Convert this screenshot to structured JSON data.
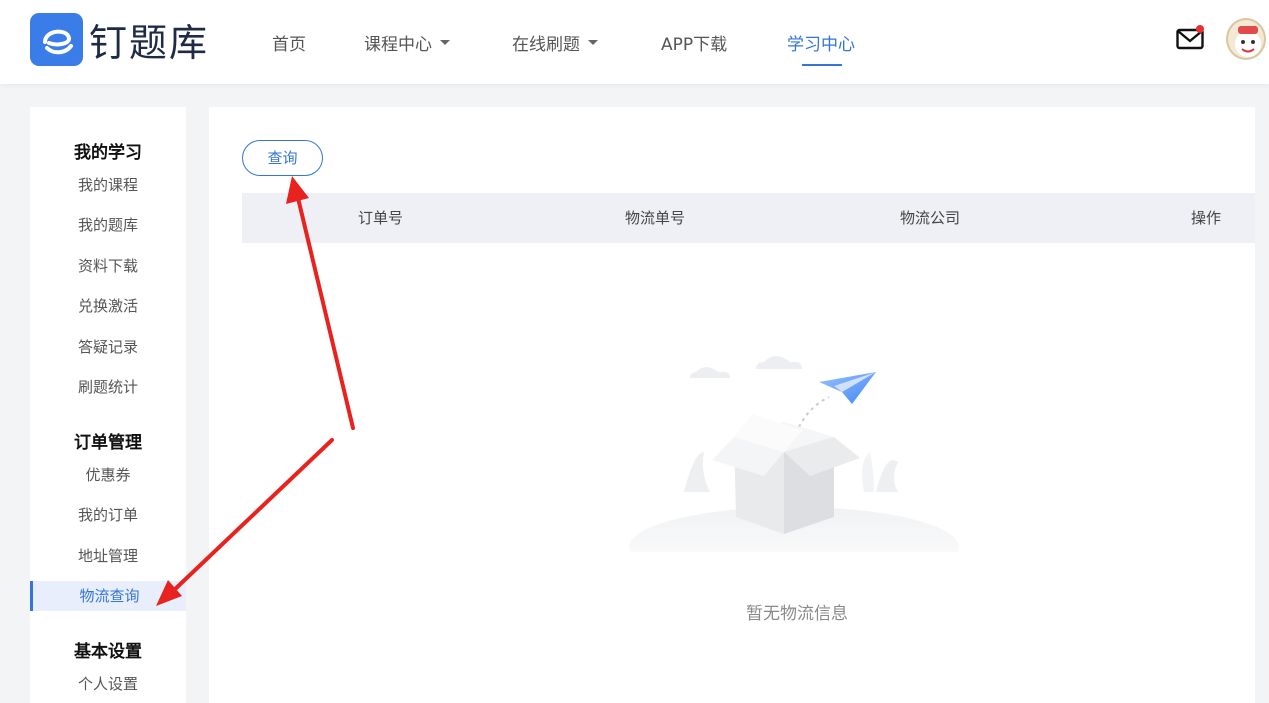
{
  "header": {
    "logo_text": "钉题库",
    "nav": [
      {
        "label": "首页",
        "dropdown": false,
        "active": false
      },
      {
        "label": "课程中心",
        "dropdown": true,
        "active": false
      },
      {
        "label": "在线刷题",
        "dropdown": true,
        "active": false
      },
      {
        "label": "APP下载",
        "dropdown": false,
        "active": false
      },
      {
        "label": "学习中心",
        "dropdown": false,
        "active": true
      }
    ],
    "accent_color": "#3575d8",
    "notification_dot_color": "#e92f2f"
  },
  "sidebar": {
    "sections": [
      {
        "title": "我的学习",
        "items": [
          "我的课程",
          "我的题库",
          "资料下载",
          "兑换激活",
          "答疑记录",
          "刷题统计"
        ]
      },
      {
        "title": "订单管理",
        "items": [
          "优惠券",
          "我的订单",
          "地址管理",
          "物流查询"
        ]
      },
      {
        "title": "基本设置",
        "items": [
          "个人设置"
        ]
      }
    ],
    "active_item": "物流查询"
  },
  "main": {
    "query_button": "查询",
    "table_headers": [
      "订单号",
      "物流单号",
      "物流公司",
      "操作"
    ],
    "empty_text": "暂无物流信息"
  },
  "annotation_color": "#e8231f"
}
